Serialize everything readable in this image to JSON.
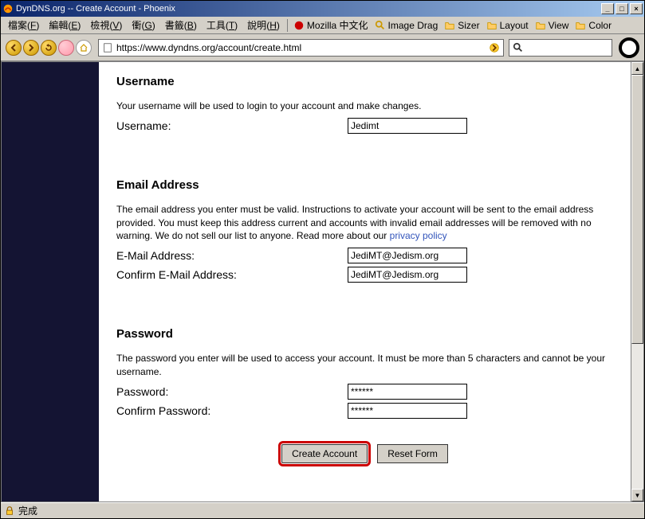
{
  "window": {
    "title": "DynDNS.org -- Create Account - Phoenix"
  },
  "menubar": {
    "items": [
      {
        "label": "檔案",
        "accel": "F"
      },
      {
        "label": "編輯",
        "accel": "E"
      },
      {
        "label": "檢視",
        "accel": "V"
      },
      {
        "label": "衝",
        "accel": "G"
      },
      {
        "label": "書籤",
        "accel": "B"
      },
      {
        "label": "工具",
        "accel": "T"
      },
      {
        "label": "說明",
        "accel": "H"
      }
    ],
    "tools": [
      {
        "label": "Mozilla 中文化",
        "icon": "mozilla"
      },
      {
        "label": "Image Drag",
        "icon": "magnify"
      },
      {
        "label": "Sizer",
        "icon": "folder"
      },
      {
        "label": "Layout",
        "icon": "folder"
      },
      {
        "label": "View",
        "icon": "folder"
      },
      {
        "label": "Color",
        "icon": "folder"
      }
    ]
  },
  "toolbar": {
    "url": "https://www.dyndns.org/account/create.html",
    "search": ""
  },
  "page": {
    "sections": {
      "username": {
        "heading": "Username",
        "help": "Your username will be used to login to your account and make changes.",
        "label": "Username:",
        "value": "Jedimt"
      },
      "email": {
        "heading": "Email Address",
        "help_a": "The email address you enter must be valid. Instructions to activate your account will be sent to the email address provided. You must keep this address current and accounts with invalid email addresses will be removed with no warning. We do not sell our list to anyone. Read more about our ",
        "help_link": "privacy policy",
        "label1": "E-Mail Address:",
        "value1": "JediMT@Jedism.org",
        "label2": "Confirm E-Mail Address:",
        "value2": "JediMT@Jedism.org"
      },
      "password": {
        "heading": "Password",
        "help": "The password you enter will be used to access your account. It must be more than 5 characters and cannot be your username.",
        "label1": "Password:",
        "value1": "******",
        "label2": "Confirm Password:",
        "value2": "******"
      }
    },
    "buttons": {
      "create": "Create Account",
      "reset": "Reset Form"
    }
  },
  "statusbar": {
    "text": "完成"
  }
}
